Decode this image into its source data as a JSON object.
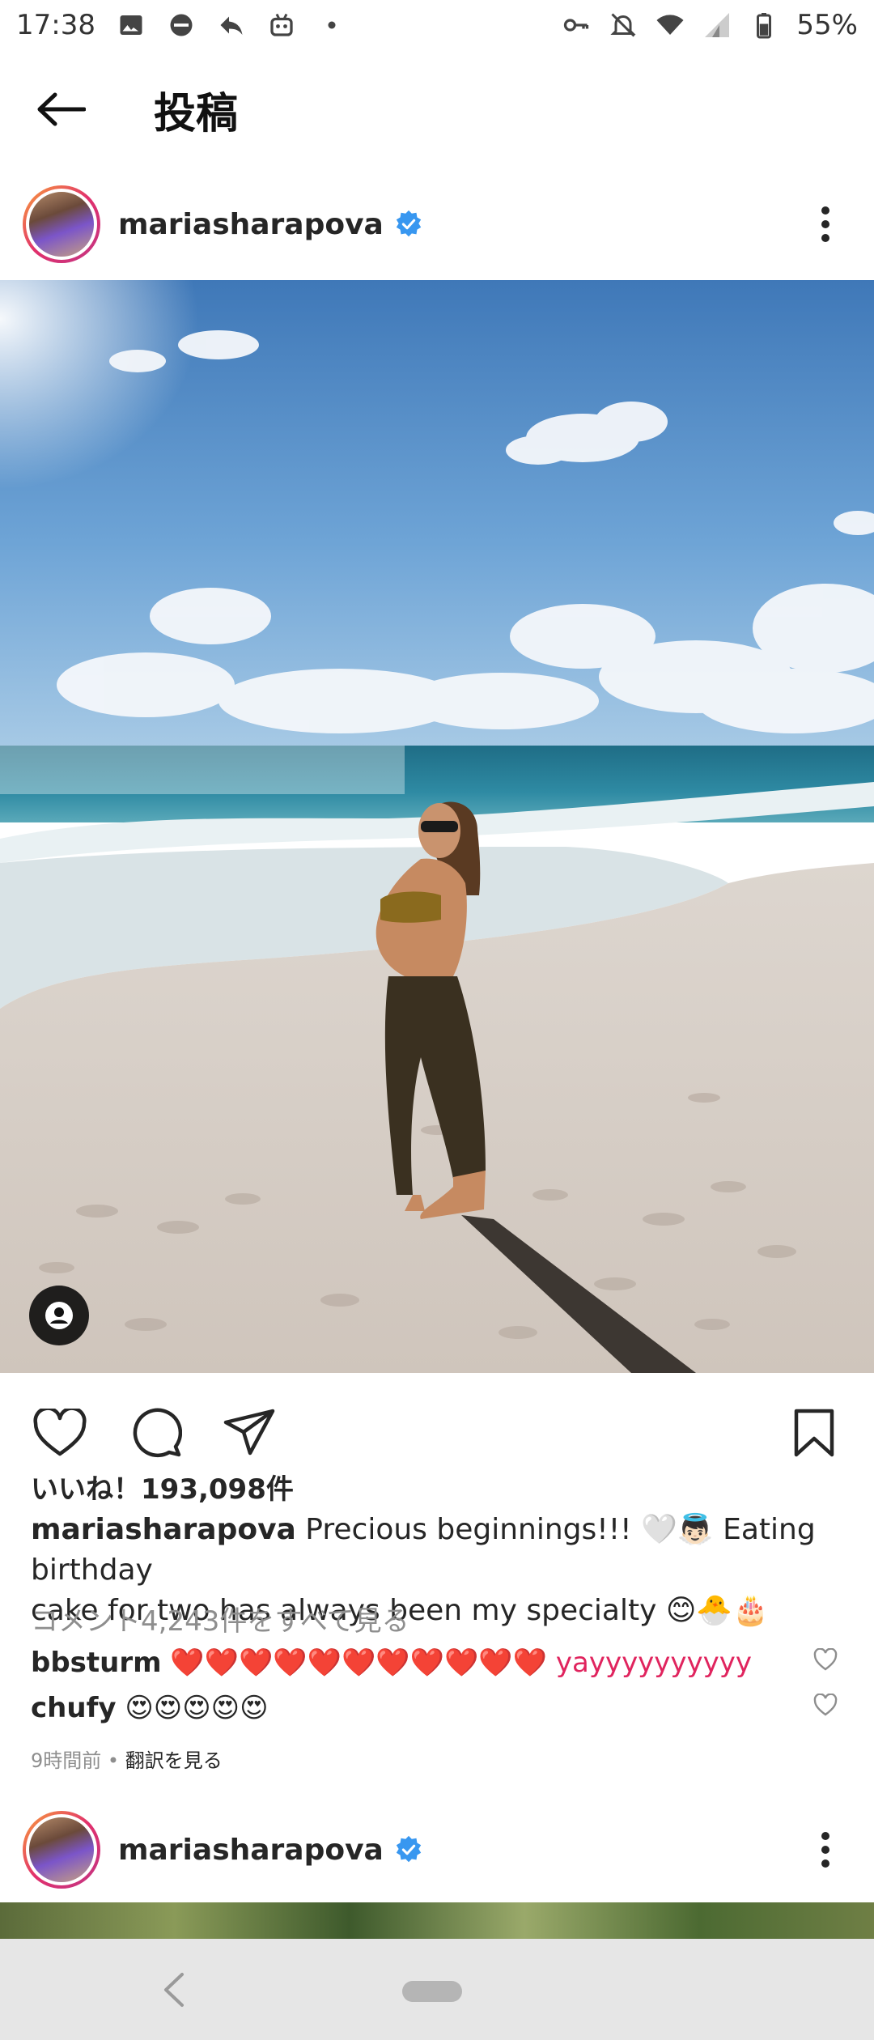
{
  "status_bar": {
    "time": "17:38",
    "battery": "55%",
    "icons": [
      "image-icon",
      "no-disturb-icon",
      "reply-icon",
      "robot-icon",
      "dot-icon",
      "key-icon",
      "bell-off-icon",
      "wifi-icon",
      "signal-icon",
      "battery-icon"
    ]
  },
  "header": {
    "title": "投稿",
    "back_icon": "arrow-left-icon"
  },
  "post": {
    "username": "mariasharapova",
    "verified": true,
    "likes": "いいね！193,098件",
    "caption_user": "mariasharapova",
    "caption_text_1": " Precious beginnings!!! 🤍👼🏻 Eating birthday",
    "caption_text_2": "cake for two has always been my specialty 😊🐣🎂",
    "view_comments": "コメント4,243件をすべて見る",
    "comments": [
      {
        "user": "bbsturm",
        "text": " ❤️❤️❤️❤️❤️❤️❤️❤️❤️❤️❤️ yayyyyyyyyyy"
      },
      {
        "user": "chufy",
        "text": " 😍😍😍😍😍"
      }
    ],
    "time_ago": "9時間前",
    "separator": " • ",
    "translate": "翻訳を見る"
  },
  "next_post": {
    "username": "mariasharapova",
    "verified": true
  },
  "colors": {
    "verified_blue": "#3897f0",
    "text": "#262626",
    "muted": "#8e8e8e",
    "heart_red": "#e0245e"
  }
}
